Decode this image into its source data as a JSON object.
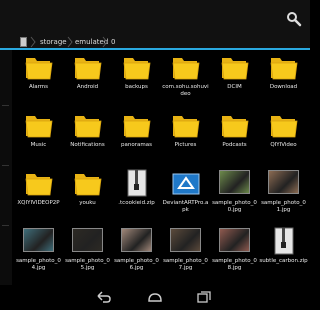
{
  "path": {
    "crumbs": [
      "storage",
      "emulated",
      "0"
    ]
  },
  "items": [
    {
      "label": "Alarms",
      "kind": "folder"
    },
    {
      "label": "Android",
      "kind": "folder"
    },
    {
      "label": "backups",
      "kind": "folder"
    },
    {
      "label": "com.sohu.sohuvideo",
      "kind": "folder"
    },
    {
      "label": "DCIM",
      "kind": "folder"
    },
    {
      "label": "Download",
      "kind": "folder"
    },
    {
      "label": "Music",
      "kind": "folder"
    },
    {
      "label": "Notifications",
      "kind": "folder"
    },
    {
      "label": "panoramas",
      "kind": "folder"
    },
    {
      "label": "Pictures",
      "kind": "folder"
    },
    {
      "label": "Podcasts",
      "kind": "folder"
    },
    {
      "label": "QIYIVideo",
      "kind": "folder"
    },
    {
      "label": "XQIYIVIDEOP2P",
      "kind": "folder"
    },
    {
      "label": "youku",
      "kind": "folder"
    },
    {
      "label": ".tcookieid.zip",
      "kind": "zip"
    },
    {
      "label": "DeviantARTPro.apk",
      "kind": "apk"
    },
    {
      "label": "sample_photo_00.jpg",
      "kind": "photo",
      "color": "#6d8a4b"
    },
    {
      "label": "sample_photo_01.jpg",
      "kind": "photo",
      "color": "#8b6b52"
    },
    {
      "label": "sample_photo_04.jpg",
      "kind": "photo",
      "color": "#3f6e7a"
    },
    {
      "label": "sample_photo_05.jpg",
      "kind": "photo",
      "color": "#2d2a24"
    },
    {
      "label": "sample_photo_06.jpg",
      "kind": "photo",
      "color": "#a08779"
    },
    {
      "label": "sample_photo_07.jpg",
      "kind": "photo",
      "color": "#5b4a3b"
    },
    {
      "label": "sample_photo_08.jpg",
      "kind": "photo",
      "color": "#8f5a4f"
    },
    {
      "label": "subtle_carbon.zip",
      "kind": "zip"
    }
  ],
  "colors": {
    "accent": "#2aa9e0",
    "folder": "#f7c91c"
  },
  "icons": {
    "search": "search-icon",
    "back": "back-icon",
    "home": "home-icon",
    "recents": "recents-icon",
    "folder": "folder-icon",
    "zip": "zip-file-icon",
    "apk": "apk-file-icon"
  }
}
